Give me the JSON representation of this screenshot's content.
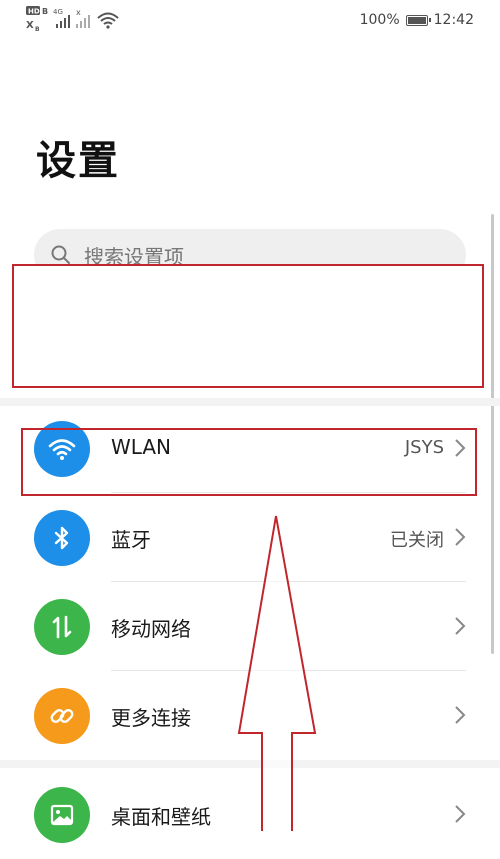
{
  "status_bar": {
    "left_indicators": [
      "HD",
      "B",
      "4G",
      "X",
      "B"
    ],
    "battery": "100%",
    "time": "12:42"
  },
  "page": {
    "title": "设置"
  },
  "search": {
    "placeholder": "搜索设置项"
  },
  "settings": [
    {
      "label": "WLAN",
      "value": "JSYS",
      "icon": "wifi-icon",
      "color": "#1e8fe8"
    },
    {
      "label": "蓝牙",
      "value": "已关闭",
      "icon": "bluetooth-icon",
      "color": "#1e8fe8"
    },
    {
      "label": "移动网络",
      "value": "",
      "icon": "mobile-network-icon",
      "color": "#3cb54a"
    },
    {
      "label": "更多连接",
      "value": "",
      "icon": "link-icon",
      "color": "#f59a1b"
    },
    {
      "label": "桌面和壁纸",
      "value": "",
      "icon": "wallpaper-icon",
      "color": "#3cb54a"
    }
  ],
  "annotation_color": "#c0262b"
}
